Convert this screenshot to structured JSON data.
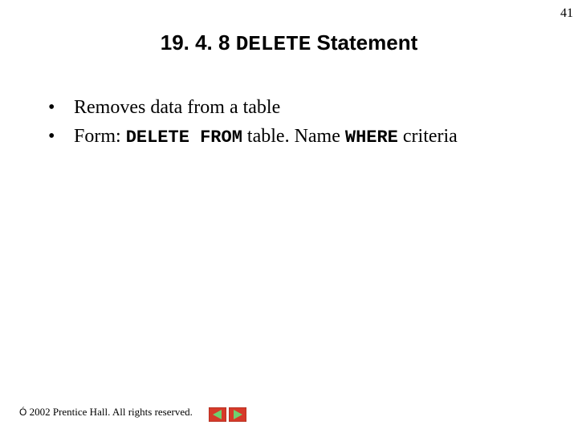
{
  "page_number": "41",
  "title": {
    "section": "19. 4. 8 ",
    "keyword": "DELETE",
    "rest": " Statement"
  },
  "bullets": [
    {
      "text": "Removes data from a table"
    },
    {
      "prefix": "Form: ",
      "kw1": "DELETE FROM",
      "mid": " table. Name ",
      "kw2": "WHERE",
      "suffix": " criteria"
    }
  ],
  "footer": {
    "symbol": "Ó",
    "text": " 2002 Prentice Hall. All rights reserved."
  },
  "icons": {
    "prev": "prev-icon",
    "next": "next-icon"
  }
}
